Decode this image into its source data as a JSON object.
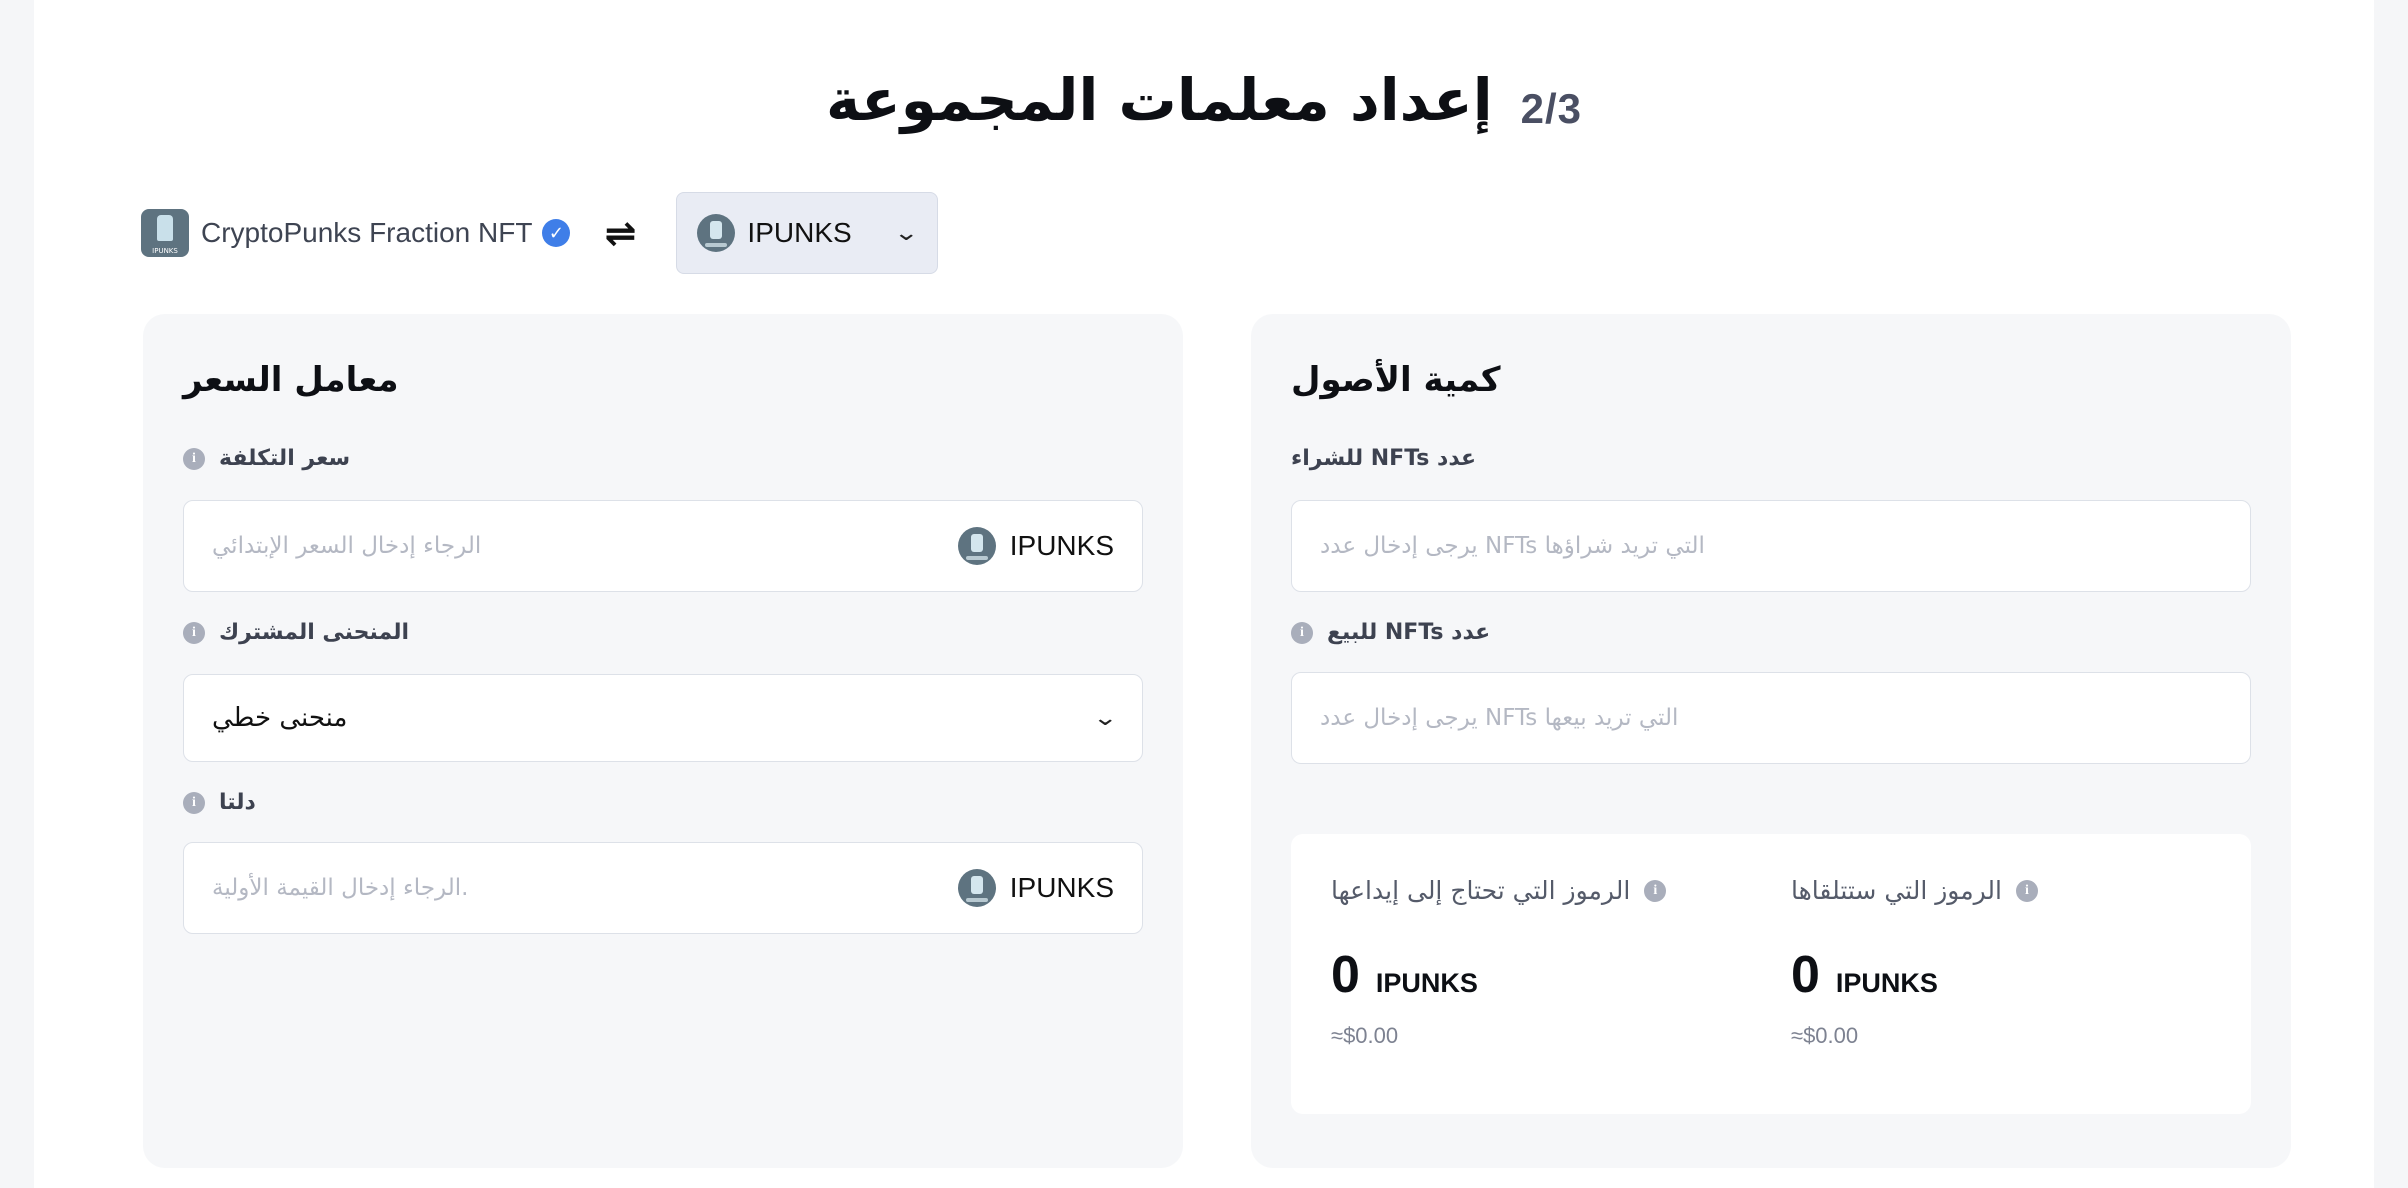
{
  "header": {
    "step": "2/3",
    "title": "إعداد معلمات المجموعة"
  },
  "pair": {
    "nft_name": "CryptoPunks Fraction NFT",
    "nft_thumb_tag": "IPUNKS",
    "token": "IPUNKS",
    "verified_icon": "verified-icon",
    "swap_icon": "⇌"
  },
  "price_panel": {
    "title": "معامل السعر",
    "cost_label": "سعر التكلفة",
    "cost_placeholder": "الرجاء إدخال السعر الإبتدائي",
    "cost_unit": "IPUNKS",
    "curve_label": "المنحنى المشترك",
    "curve_value": "منحنى خطي",
    "delta_label": "دلتا",
    "delta_placeholder": "الرجاء إدخال القيمة الأولية.",
    "delta_unit": "IPUNKS"
  },
  "asset_panel": {
    "title": "كمية الأصول",
    "buy_label": "عدد NFTs للشراء",
    "buy_placeholder": "يرجى إدخال عدد NFTs التي تريد شراؤها",
    "sell_label": "عدد NFTs للبيع",
    "sell_placeholder": "يرجى إدخال عدد NFTs التي تريد بيعها",
    "deposit": {
      "label": "الرموز التي تحتاج إلى إيداعها",
      "amount": "0",
      "unit": "IPUNKS",
      "usd": "≈$0.00"
    },
    "receive": {
      "label": "الرموز التي ستتلقاها",
      "amount": "0",
      "unit": "IPUNKS",
      "usd": "≈$0.00"
    }
  },
  "colors": {
    "accent_verified": "#3f7ee8",
    "panel_bg": "#f6f7f9",
    "placeholder": "#b4b8c3"
  }
}
